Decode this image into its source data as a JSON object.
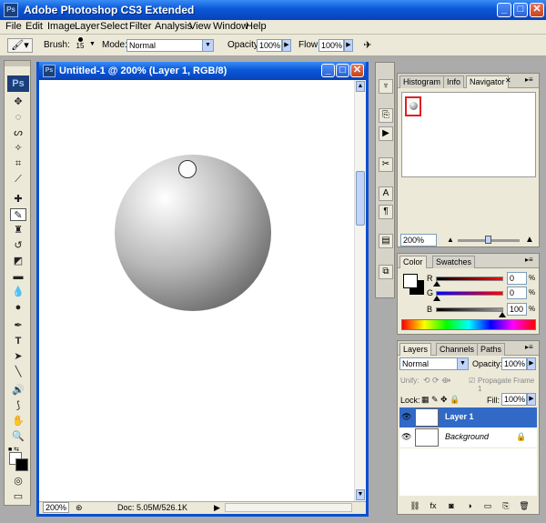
{
  "app": {
    "title": "Adobe Photoshop CS3 Extended",
    "logo": "Ps",
    "window_buttons": {
      "minimize": "_",
      "maximize": "□",
      "close": "✕"
    }
  },
  "menu": [
    "File",
    "Edit",
    "Image",
    "Layer",
    "Select",
    "Filter",
    "Analysis",
    "View",
    "Window",
    "Help"
  ],
  "options_bar": {
    "brush_label": "Brush:",
    "brush_size": "15",
    "mode_label": "Mode:",
    "mode_value": "Normal",
    "opacity_label": "Opacity:",
    "opacity_value": "100%",
    "flow_label": "Flow:",
    "flow_value": "100%"
  },
  "toolbox": {
    "logo": "Ps",
    "tools": [
      "move-tool-icon",
      "marquee-tool-icon",
      "lasso-tool-icon",
      "magic-wand-icon",
      "crop-tool-icon",
      "slice-tool-icon",
      "healing-brush-icon",
      "brush-tool-icon",
      "clone-stamp-icon",
      "history-brush-icon",
      "eraser-icon",
      "gradient-tool-icon",
      "blur-tool-icon",
      "dodge-tool-icon",
      "pen-tool-icon",
      "type-tool-icon",
      "path-selection-icon",
      "line-tool-icon",
      "notes-tool-icon",
      "eyedropper-icon",
      "hand-tool-icon",
      "zoom-tool-icon"
    ],
    "active_tool": "brush-tool-icon"
  },
  "document": {
    "title": "Untitled-1 @ 200% (Layer 1, RGB/8)",
    "icon": "Ps",
    "zoom": "200%",
    "doc_info": "Doc: 5.05M/526.1K"
  },
  "navigator_panel": {
    "tabs": [
      "Histogram",
      "Info",
      "Navigator"
    ],
    "active_tab": "Navigator",
    "zoom": "200%"
  },
  "color_panel": {
    "tabs": [
      "Color",
      "Swatches"
    ],
    "active_tab": "Color",
    "r_label": "R",
    "r_value": "0",
    "g_label": "G",
    "g_value": "0",
    "b_label": "B",
    "b_value": "100",
    "r_level": 0,
    "g_level": 0,
    "b_level": 1.0
  },
  "layers_panel": {
    "tabs": [
      "Layers",
      "Channels",
      "Paths"
    ],
    "active_tab": "Layers",
    "blend_mode": "Normal",
    "opacity_label": "Opacity:",
    "opacity_value": "100%",
    "unify_label": "Unify:",
    "propagate_label": "Propagate Frame 1",
    "lock_label": "Lock:",
    "fill_label": "Fill:",
    "fill_value": "100%",
    "layers": [
      {
        "name": "Layer 1",
        "selected": true
      },
      {
        "name": "Background",
        "selected": false
      }
    ]
  }
}
